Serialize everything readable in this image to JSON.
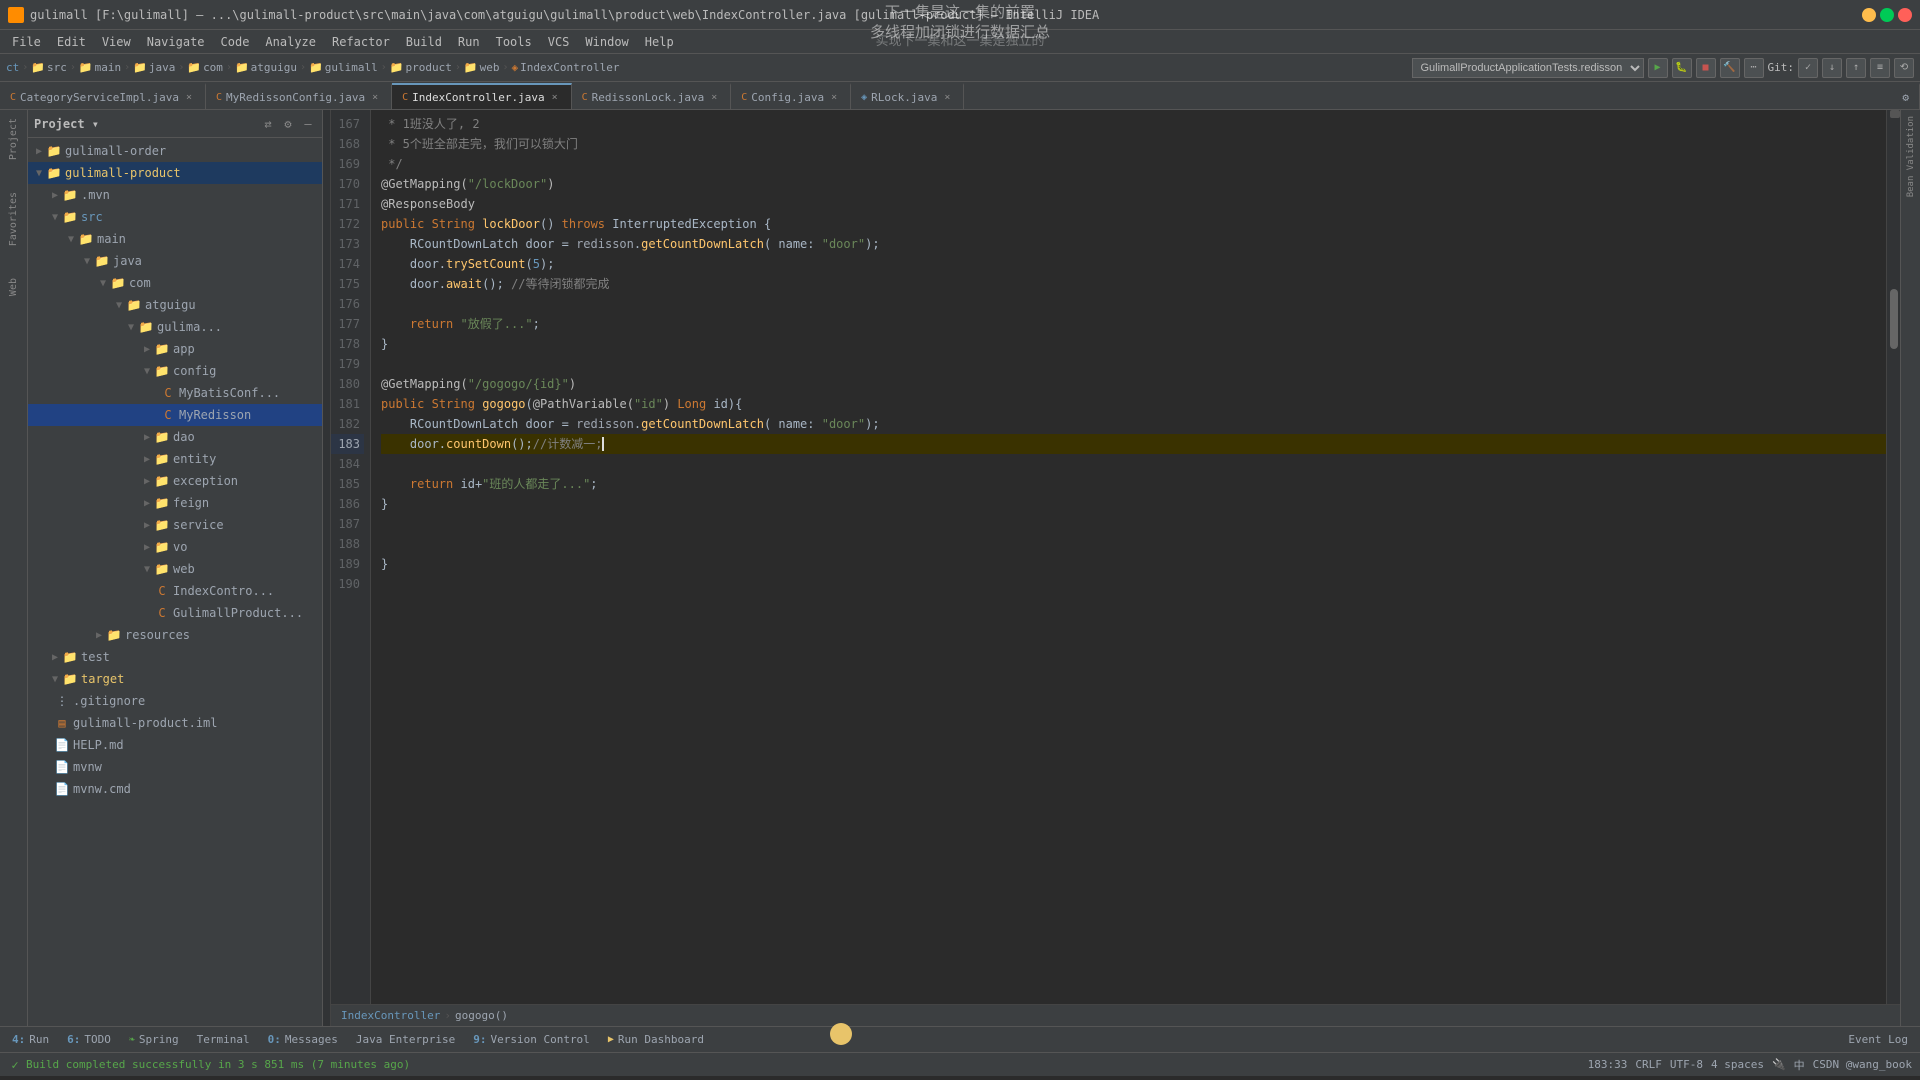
{
  "titlebar": {
    "title": "gulimall [F:\\gulimall] – ...\\gulimall-product\\src\\main\\java\\com\\atguigu\\gulimall\\product\\web\\IndexController.java [gulimall-product] – IntelliJ IDEA"
  },
  "menu": {
    "items": [
      "File",
      "Edit",
      "View",
      "Navigate",
      "Code",
      "Analyze",
      "Refactor",
      "Build",
      "Run",
      "Tools",
      "VCS",
      "Window",
      "Help"
    ]
  },
  "navbar": {
    "breadcrumb": [
      "ct",
      "src",
      "main",
      "java",
      "com",
      "atguigu",
      "gulimall",
      "product",
      "web",
      "IndexController"
    ],
    "run_config": "GulimallProductApplicationTests.redisson"
  },
  "tabs": [
    {
      "label": "CategoryServiceImpl.java",
      "icon": "C",
      "active": false
    },
    {
      "label": "MyRedissonConfig.java",
      "icon": "C",
      "active": false
    },
    {
      "label": "IndexController.java",
      "icon": "C",
      "active": true
    },
    {
      "label": "RedissonLock.java",
      "icon": "C",
      "active": false
    },
    {
      "label": "Config.java",
      "icon": "C",
      "active": false
    },
    {
      "label": "RLock.java",
      "icon": "C",
      "active": false
    }
  ],
  "sidebar": {
    "title": "Project",
    "tree": [
      {
        "level": 0,
        "type": "folder",
        "label": "gulimall-order",
        "expanded": false
      },
      {
        "level": 0,
        "type": "folder",
        "label": "gulimall-product",
        "expanded": true
      },
      {
        "level": 1,
        "type": "folder",
        "label": ".mvn",
        "expanded": false
      },
      {
        "level": 1,
        "type": "folder",
        "label": "src",
        "expanded": true
      },
      {
        "level": 2,
        "type": "folder",
        "label": "main",
        "expanded": true
      },
      {
        "level": 3,
        "type": "folder",
        "label": "java",
        "expanded": true
      },
      {
        "level": 4,
        "type": "folder",
        "label": "com",
        "expanded": true
      },
      {
        "level": 5,
        "type": "folder",
        "label": "atguigu",
        "expanded": true
      },
      {
        "level": 6,
        "type": "folder",
        "label": "gulima...",
        "expanded": true
      },
      {
        "level": 7,
        "type": "folder",
        "label": "app",
        "expanded": false
      },
      {
        "level": 7,
        "type": "folder",
        "label": "config",
        "expanded": true
      },
      {
        "level": 8,
        "type": "java",
        "label": "MyBatisConf..."
      },
      {
        "level": 8,
        "type": "java",
        "label": "MyRedisson",
        "selected": true
      },
      {
        "level": 7,
        "type": "folder",
        "label": "dao",
        "expanded": false
      },
      {
        "level": 7,
        "type": "folder",
        "label": "entity",
        "expanded": false
      },
      {
        "level": 7,
        "type": "folder",
        "label": "exception",
        "expanded": false
      },
      {
        "level": 7,
        "type": "folder",
        "label": "feign",
        "expanded": false
      },
      {
        "level": 7,
        "type": "folder",
        "label": "service",
        "expanded": false
      },
      {
        "level": 7,
        "type": "folder",
        "label": "vo",
        "expanded": false
      },
      {
        "level": 7,
        "type": "folder",
        "label": "web",
        "expanded": true
      },
      {
        "level": 8,
        "type": "java",
        "label": "IndexContro..."
      },
      {
        "level": 8,
        "type": "java",
        "label": "GulimallProduct..."
      },
      {
        "level": 2,
        "type": "folder",
        "label": "resources",
        "expanded": false
      },
      {
        "level": 1,
        "type": "folder",
        "label": "test",
        "expanded": false
      },
      {
        "level": 1,
        "type": "folder",
        "label": "target",
        "expanded": false
      },
      {
        "level": 1,
        "type": "file",
        "label": ".gitignore"
      },
      {
        "level": 1,
        "type": "file",
        "label": "gulimall-product.iml"
      },
      {
        "level": 1,
        "type": "file",
        "label": "HELP.md"
      },
      {
        "level": 1,
        "type": "file",
        "label": "mvnw"
      },
      {
        "level": 1,
        "type": "file",
        "label": "mvnw.cmd"
      }
    ]
  },
  "code": {
    "lines": [
      {
        "num": 167,
        "content": " * 1班没人了, 2"
      },
      {
        "num": 168,
        "content": " * 5个班全部走完，我们可以锁大门"
      },
      {
        "num": 169,
        "content": " */"
      },
      {
        "num": 170,
        "content": "@GetMapping(\"/lockDoor\")"
      },
      {
        "num": 171,
        "content": "@ResponseBody"
      },
      {
        "num": 172,
        "content": "public String lockDoor() throws InterruptedException {"
      },
      {
        "num": 173,
        "content": "    RCountDownLatch door = redisson.getCountDownLatch( name: \"door\");"
      },
      {
        "num": 174,
        "content": "    door.trySetCount(5);"
      },
      {
        "num": 175,
        "content": "    door.await(); //等待闭锁都完成"
      },
      {
        "num": 176,
        "content": ""
      },
      {
        "num": 177,
        "content": "    return \"放假了...\";"
      },
      {
        "num": 178,
        "content": "}"
      },
      {
        "num": 179,
        "content": ""
      },
      {
        "num": 180,
        "content": "@GetMapping(\"/gogogo/{id}\")"
      },
      {
        "num": 181,
        "content": "public String gogogo(@PathVariable(\"id\") Long id){"
      },
      {
        "num": 182,
        "content": "    RCountDownLatch door = redisson.getCountDownLatch( name: \"door\");"
      },
      {
        "num": 183,
        "content": "    door.countDown();//计数减一;"
      },
      {
        "num": 184,
        "content": ""
      },
      {
        "num": 185,
        "content": "    return id+\"班的人都走了...\";"
      },
      {
        "num": 186,
        "content": "}"
      },
      {
        "num": 187,
        "content": ""
      },
      {
        "num": 188,
        "content": ""
      },
      {
        "num": 189,
        "content": "}"
      },
      {
        "num": 190,
        "content": ""
      }
    ]
  },
  "breadcrumb": {
    "parts": [
      "IndexController",
      "gogogo()"
    ]
  },
  "bottom_tabs": [
    {
      "num": "4",
      "label": "Run"
    },
    {
      "num": "6",
      "label": "TODO"
    },
    {
      "label": "Spring"
    },
    {
      "label": "Terminal"
    },
    {
      "num": "0",
      "label": "Messages"
    },
    {
      "label": "Java Enterprise"
    },
    {
      "num": "9",
      "label": "Version Control"
    },
    {
      "label": "Run Dashboard"
    },
    {
      "label": "Event Log"
    }
  ],
  "status": {
    "build_message": "Build completed successfully in 3 s 851 ms (7 minutes ago)",
    "position": "183:33",
    "line_ending": "CRLF",
    "encoding": "UTF-8",
    "indent": "4 spaces"
  },
  "overlays": {
    "line1": "下一集是这一集的前置",
    "line2": "多线程加闭锁进行数据汇总",
    "line3": "实现下一集和这一集是独立的"
  }
}
